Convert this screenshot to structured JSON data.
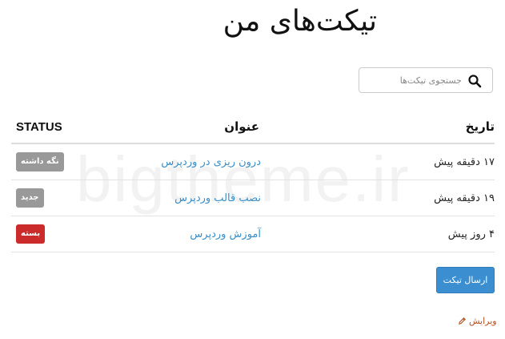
{
  "page": {
    "title": "تیکت‌های من",
    "watermark": "bigtheme.ir"
  },
  "search": {
    "placeholder": "جستجوی تیکت‌ها",
    "icon": "search-icon"
  },
  "table": {
    "headers": {
      "status": "STATUS",
      "subject": "عنوان",
      "date": "تاریخ"
    },
    "rows": [
      {
        "status": "نگه داشته",
        "status_color": "#999999",
        "subject": "درون ریزی در وردپرس",
        "date": "۱۷ دقیقه پیش"
      },
      {
        "status": "جدید",
        "status_color": "#999999",
        "subject": "نصب قالب وردپرس",
        "date": "۱۹ دقیقه پیش"
      },
      {
        "status": "بسته",
        "status_color": "#cc2b2b",
        "subject": "آموزش وردپرس",
        "date": "۴ روز پیش"
      }
    ]
  },
  "actions": {
    "send_ticket": "ارسال تیکت",
    "edit": "ویرایش",
    "edit_icon": "pencil-icon"
  },
  "colors": {
    "link": "#3a8fc7",
    "primary_button": "#3b8fd1",
    "edit_link": "#b3501f"
  }
}
